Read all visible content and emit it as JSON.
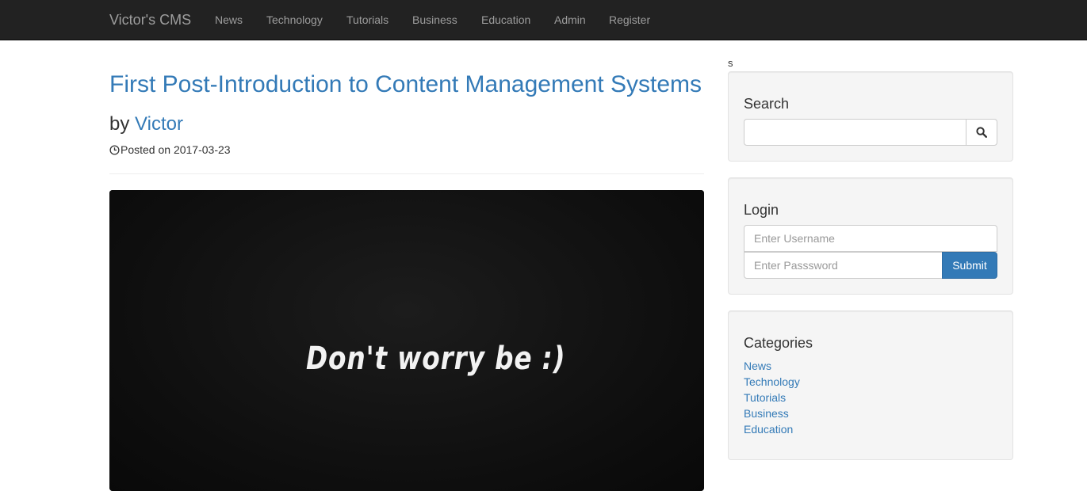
{
  "navbar": {
    "brand": "Victor's CMS",
    "items": [
      {
        "label": "News"
      },
      {
        "label": "Technology"
      },
      {
        "label": "Tutorials"
      },
      {
        "label": "Business"
      },
      {
        "label": "Education"
      },
      {
        "label": "Admin"
      },
      {
        "label": "Register"
      }
    ]
  },
  "post": {
    "title": "First Post-Introduction to Content Management Systems",
    "by_prefix": "by",
    "author": "Victor",
    "posted_label": "Posted on 2017-03-23",
    "image_text": "Don't worry be :)"
  },
  "sidebar": {
    "stray_text": "s",
    "search": {
      "heading": "Search",
      "placeholder": "",
      "icon": "search-icon"
    },
    "login": {
      "heading": "Login",
      "username_placeholder": "Enter Username",
      "password_placeholder": "Enter Passsword",
      "submit_label": "Submit"
    },
    "categories": {
      "heading": "Categories",
      "items": [
        {
          "label": "News"
        },
        {
          "label": "Technology"
        },
        {
          "label": "Tutorials"
        },
        {
          "label": "Business"
        },
        {
          "label": "Education"
        }
      ]
    }
  },
  "colors": {
    "navbar_bg": "#222222",
    "nav_text": "#9d9d9d",
    "link": "#337ab7",
    "well_bg": "#f5f5f5",
    "button_primary": "#337ab7"
  }
}
